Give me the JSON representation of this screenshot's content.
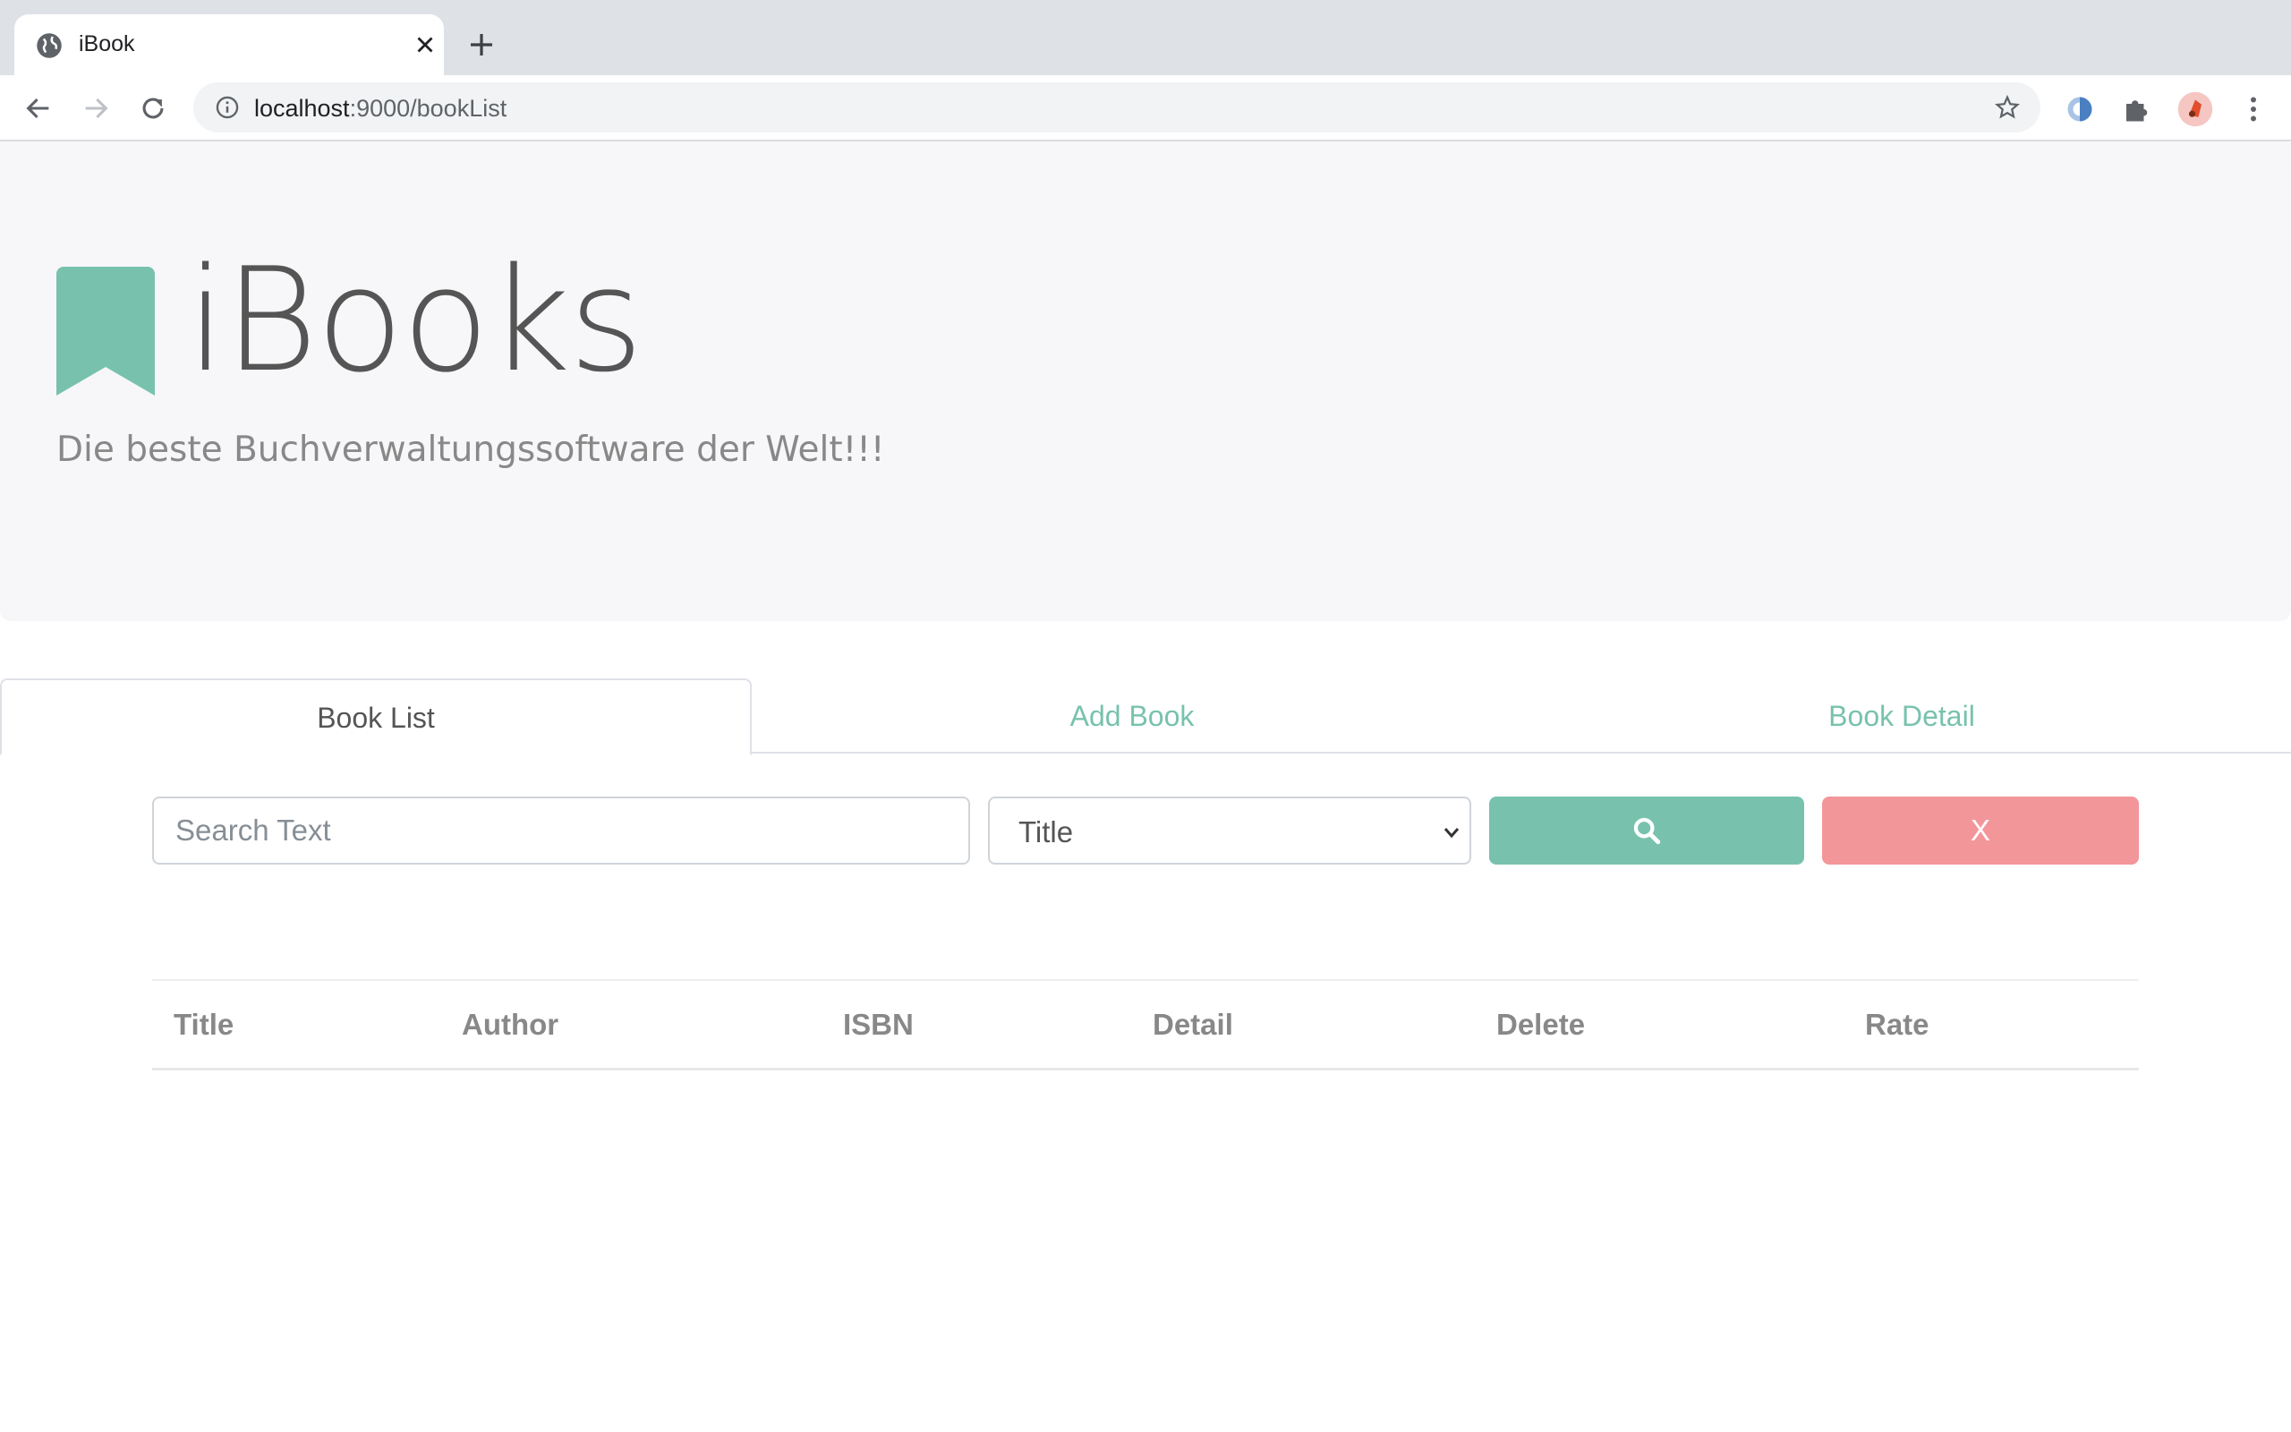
{
  "browser": {
    "tab_title": "iBook",
    "url_host": "localhost",
    "url_path": ":9000/bookList"
  },
  "hero": {
    "title": "iBooks",
    "subtitle": "Die beste Buchverwaltungssoftware der Welt!!!"
  },
  "tabs": [
    {
      "label": "Book List",
      "active": true
    },
    {
      "label": "Add Book",
      "active": false
    },
    {
      "label": "Book Detail",
      "active": false
    }
  ],
  "search": {
    "placeholder": "Search Text",
    "field_selected": "Title",
    "clear_label": "X"
  },
  "table": {
    "headers": [
      "Title",
      "Author",
      "ISBN",
      "Detail",
      "Delete",
      "Rate"
    ]
  },
  "colors": {
    "primary": "#78c2ad",
    "danger": "#f3969a",
    "hero_bg": "#f7f7f9"
  }
}
